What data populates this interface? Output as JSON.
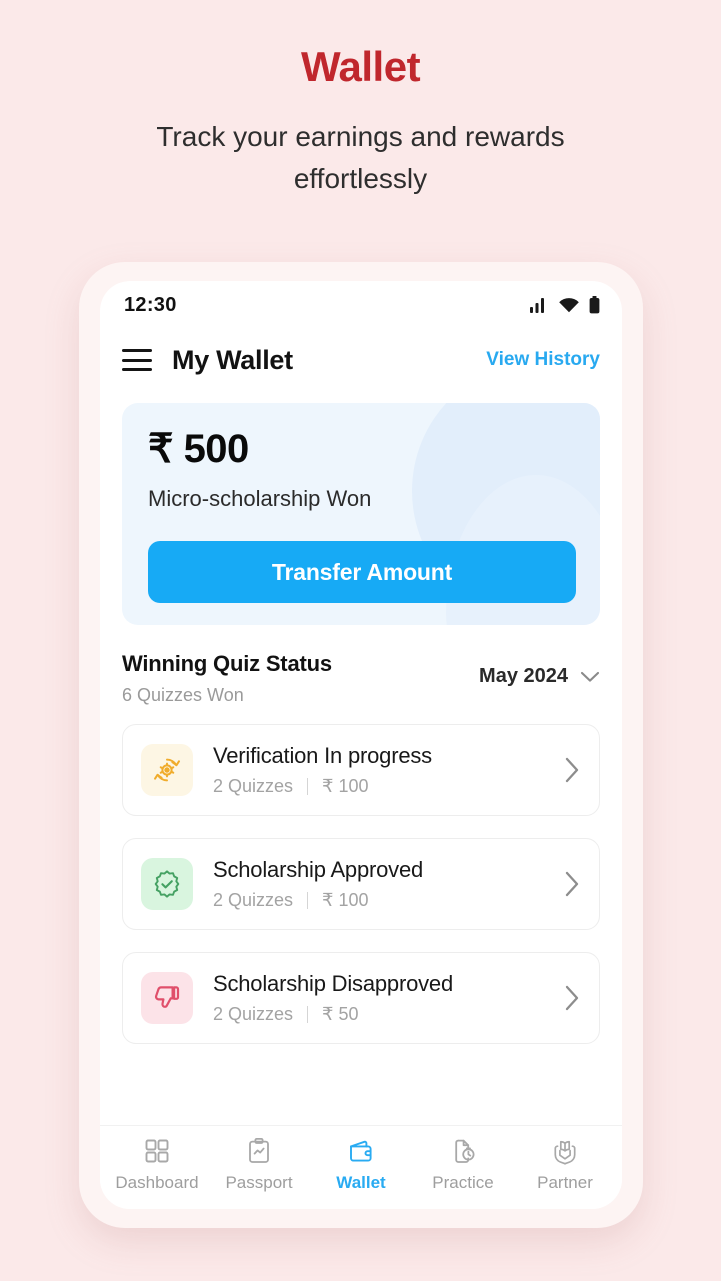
{
  "promo": {
    "title": "Wallet",
    "subtitle": "Track your earnings and rewards effortlessly",
    "title_color": "#c0272d",
    "background_color": "#fbe9e9"
  },
  "status_bar": {
    "time": "12:30",
    "icons": [
      "signal-icon",
      "wifi-icon",
      "battery-icon"
    ]
  },
  "app_bar": {
    "menu_icon": "hamburger-menu-icon",
    "title": "My Wallet",
    "action_label": "View History",
    "action_color": "#28a9f0"
  },
  "balance_card": {
    "amount": "₹ 500",
    "label": "Micro-scholarship Won",
    "button_label": "Transfer Amount",
    "button_color": "#17aaf5",
    "card_color": "#eef6fd"
  },
  "section": {
    "title": "Winning Quiz Status",
    "subtitle": "6 Quizzes Won",
    "month": "May 2024",
    "month_chevron_icon": "chevron-down-icon"
  },
  "status_items": [
    {
      "title": "Verification In progress",
      "quizzes": "2 Quizzes",
      "amount": "₹ 100",
      "icon": "gear-refresh-icon",
      "icon_color": "#f0ac2c",
      "icon_bg": "#fdf6e4"
    },
    {
      "title": "Scholarship Approved",
      "quizzes": "2 Quizzes",
      "amount": "₹ 100",
      "icon": "verified-badge-check-icon",
      "icon_color": "#45a163",
      "icon_bg": "#d9f5df"
    },
    {
      "title": "Scholarship Disapproved",
      "quizzes": "2 Quizzes",
      "amount": "₹ 50",
      "icon": "thumbs-down-icon",
      "icon_color": "#e0506b",
      "icon_bg": "#fce3e8"
    }
  ],
  "bottom_nav": {
    "active_color": "#29abf2",
    "inactive_color": "#9e9e9e",
    "items": [
      {
        "label": "Dashboard",
        "icon": "grid-squares-icon",
        "active": false
      },
      {
        "label": "Passport",
        "icon": "clipboard-chart-icon",
        "active": false
      },
      {
        "label": "Wallet",
        "icon": "wallet-icon",
        "active": true
      },
      {
        "label": "Practice",
        "icon": "document-timer-icon",
        "active": false
      },
      {
        "label": "Partner",
        "icon": "hands-book-icon",
        "active": false
      }
    ]
  }
}
